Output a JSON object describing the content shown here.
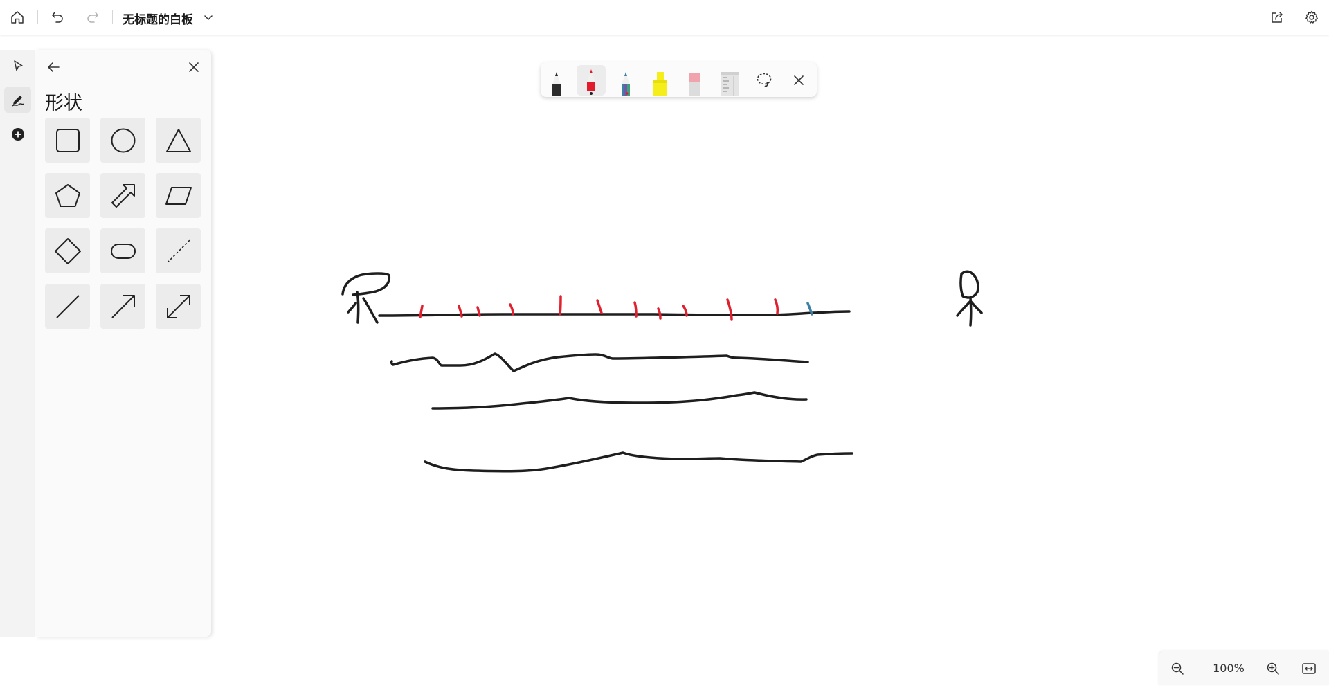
{
  "header": {
    "title": "无标题的白板"
  },
  "panel": {
    "title": "形状",
    "shapes": [
      "square",
      "circle",
      "triangle",
      "pentagon",
      "arrow-block",
      "parallelogram",
      "diamond",
      "rounded-rectangle",
      "dashed-line",
      "line",
      "arrow",
      "double-arrow"
    ]
  },
  "pen_toolbar": {
    "tools": [
      "black-pen",
      "red-pen",
      "galaxy-pen",
      "yellow-highlighter",
      "eraser",
      "ruler",
      "lasso-select",
      "close"
    ],
    "active": "red-pen"
  },
  "zoom": {
    "value": "100%"
  },
  "colors": {
    "ink": "#1e1e1e",
    "red_ink": "#e0202e",
    "blue_ink": "#3f7fa3",
    "highlighter": "#f5ee1a"
  }
}
